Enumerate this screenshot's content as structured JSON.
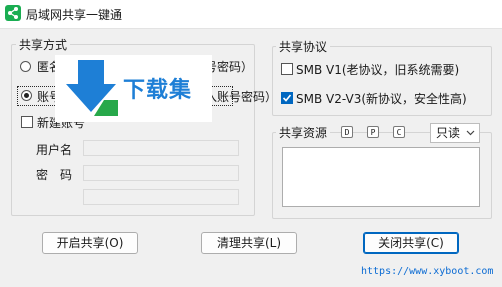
{
  "window": {
    "title": "局域网共享一键通"
  },
  "share_mode": {
    "group_title": "共享方式",
    "options": [
      {
        "label": "匿名共享（访问共享无需输入账号密码）",
        "selected": false
      },
      {
        "label": "账号密码共享（访问共享需要输入账号密码）",
        "selected": true
      }
    ],
    "new_account": {
      "label": "新建账号",
      "checked": false
    },
    "username_label": "用户名",
    "password_label": "密　码",
    "username_value": "",
    "password_value": ""
  },
  "protocol": {
    "group_title": "共享协议",
    "smb_v1": {
      "label": "SMB V1(老协议，旧系统需要)",
      "checked": false
    },
    "smb_v2_v3": {
      "label": "SMB V2-V3(新协议，安全性高)",
      "checked": true
    }
  },
  "resources": {
    "label": "共享资源",
    "drives": [
      "D",
      "P",
      "C"
    ],
    "permission": {
      "value": "只读"
    }
  },
  "buttons": {
    "start": "开启共享(O)",
    "clear": "清理共享(L)",
    "close": "关闭共享(C)"
  },
  "footer": {
    "url": "https://www.xyboot.com"
  },
  "watermark": {
    "text": "下载集"
  },
  "colors": {
    "accent": "#0067c0",
    "app_icon": "#1aad52",
    "link": "#0b6bd3"
  }
}
